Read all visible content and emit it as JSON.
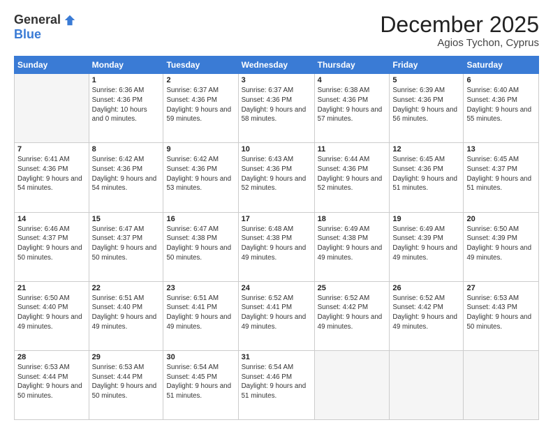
{
  "header": {
    "logo_general": "General",
    "logo_blue": "Blue",
    "month": "December 2025",
    "location": "Agios Tychon, Cyprus"
  },
  "weekdays": [
    "Sunday",
    "Monday",
    "Tuesday",
    "Wednesday",
    "Thursday",
    "Friday",
    "Saturday"
  ],
  "weeks": [
    [
      {
        "day": "",
        "sunrise": "",
        "sunset": "",
        "daylight": ""
      },
      {
        "day": "1",
        "sunrise": "Sunrise: 6:36 AM",
        "sunset": "Sunset: 4:36 PM",
        "daylight": "Daylight: 10 hours and 0 minutes."
      },
      {
        "day": "2",
        "sunrise": "Sunrise: 6:37 AM",
        "sunset": "Sunset: 4:36 PM",
        "daylight": "Daylight: 9 hours and 59 minutes."
      },
      {
        "day": "3",
        "sunrise": "Sunrise: 6:37 AM",
        "sunset": "Sunset: 4:36 PM",
        "daylight": "Daylight: 9 hours and 58 minutes."
      },
      {
        "day": "4",
        "sunrise": "Sunrise: 6:38 AM",
        "sunset": "Sunset: 4:36 PM",
        "daylight": "Daylight: 9 hours and 57 minutes."
      },
      {
        "day": "5",
        "sunrise": "Sunrise: 6:39 AM",
        "sunset": "Sunset: 4:36 PM",
        "daylight": "Daylight: 9 hours and 56 minutes."
      },
      {
        "day": "6",
        "sunrise": "Sunrise: 6:40 AM",
        "sunset": "Sunset: 4:36 PM",
        "daylight": "Daylight: 9 hours and 55 minutes."
      }
    ],
    [
      {
        "day": "7",
        "sunrise": "Sunrise: 6:41 AM",
        "sunset": "Sunset: 4:36 PM",
        "daylight": "Daylight: 9 hours and 54 minutes."
      },
      {
        "day": "8",
        "sunrise": "Sunrise: 6:42 AM",
        "sunset": "Sunset: 4:36 PM",
        "daylight": "Daylight: 9 hours and 54 minutes."
      },
      {
        "day": "9",
        "sunrise": "Sunrise: 6:42 AM",
        "sunset": "Sunset: 4:36 PM",
        "daylight": "Daylight: 9 hours and 53 minutes."
      },
      {
        "day": "10",
        "sunrise": "Sunrise: 6:43 AM",
        "sunset": "Sunset: 4:36 PM",
        "daylight": "Daylight: 9 hours and 52 minutes."
      },
      {
        "day": "11",
        "sunrise": "Sunrise: 6:44 AM",
        "sunset": "Sunset: 4:36 PM",
        "daylight": "Daylight: 9 hours and 52 minutes."
      },
      {
        "day": "12",
        "sunrise": "Sunrise: 6:45 AM",
        "sunset": "Sunset: 4:36 PM",
        "daylight": "Daylight: 9 hours and 51 minutes."
      },
      {
        "day": "13",
        "sunrise": "Sunrise: 6:45 AM",
        "sunset": "Sunset: 4:37 PM",
        "daylight": "Daylight: 9 hours and 51 minutes."
      }
    ],
    [
      {
        "day": "14",
        "sunrise": "Sunrise: 6:46 AM",
        "sunset": "Sunset: 4:37 PM",
        "daylight": "Daylight: 9 hours and 50 minutes."
      },
      {
        "day": "15",
        "sunrise": "Sunrise: 6:47 AM",
        "sunset": "Sunset: 4:37 PM",
        "daylight": "Daylight: 9 hours and 50 minutes."
      },
      {
        "day": "16",
        "sunrise": "Sunrise: 6:47 AM",
        "sunset": "Sunset: 4:38 PM",
        "daylight": "Daylight: 9 hours and 50 minutes."
      },
      {
        "day": "17",
        "sunrise": "Sunrise: 6:48 AM",
        "sunset": "Sunset: 4:38 PM",
        "daylight": "Daylight: 9 hours and 49 minutes."
      },
      {
        "day": "18",
        "sunrise": "Sunrise: 6:49 AM",
        "sunset": "Sunset: 4:38 PM",
        "daylight": "Daylight: 9 hours and 49 minutes."
      },
      {
        "day": "19",
        "sunrise": "Sunrise: 6:49 AM",
        "sunset": "Sunset: 4:39 PM",
        "daylight": "Daylight: 9 hours and 49 minutes."
      },
      {
        "day": "20",
        "sunrise": "Sunrise: 6:50 AM",
        "sunset": "Sunset: 4:39 PM",
        "daylight": "Daylight: 9 hours and 49 minutes."
      }
    ],
    [
      {
        "day": "21",
        "sunrise": "Sunrise: 6:50 AM",
        "sunset": "Sunset: 4:40 PM",
        "daylight": "Daylight: 9 hours and 49 minutes."
      },
      {
        "day": "22",
        "sunrise": "Sunrise: 6:51 AM",
        "sunset": "Sunset: 4:40 PM",
        "daylight": "Daylight: 9 hours and 49 minutes."
      },
      {
        "day": "23",
        "sunrise": "Sunrise: 6:51 AM",
        "sunset": "Sunset: 4:41 PM",
        "daylight": "Daylight: 9 hours and 49 minutes."
      },
      {
        "day": "24",
        "sunrise": "Sunrise: 6:52 AM",
        "sunset": "Sunset: 4:41 PM",
        "daylight": "Daylight: 9 hours and 49 minutes."
      },
      {
        "day": "25",
        "sunrise": "Sunrise: 6:52 AM",
        "sunset": "Sunset: 4:42 PM",
        "daylight": "Daylight: 9 hours and 49 minutes."
      },
      {
        "day": "26",
        "sunrise": "Sunrise: 6:52 AM",
        "sunset": "Sunset: 4:42 PM",
        "daylight": "Daylight: 9 hours and 49 minutes."
      },
      {
        "day": "27",
        "sunrise": "Sunrise: 6:53 AM",
        "sunset": "Sunset: 4:43 PM",
        "daylight": "Daylight: 9 hours and 50 minutes."
      }
    ],
    [
      {
        "day": "28",
        "sunrise": "Sunrise: 6:53 AM",
        "sunset": "Sunset: 4:44 PM",
        "daylight": "Daylight: 9 hours and 50 minutes."
      },
      {
        "day": "29",
        "sunrise": "Sunrise: 6:53 AM",
        "sunset": "Sunset: 4:44 PM",
        "daylight": "Daylight: 9 hours and 50 minutes."
      },
      {
        "day": "30",
        "sunrise": "Sunrise: 6:54 AM",
        "sunset": "Sunset: 4:45 PM",
        "daylight": "Daylight: 9 hours and 51 minutes."
      },
      {
        "day": "31",
        "sunrise": "Sunrise: 6:54 AM",
        "sunset": "Sunset: 4:46 PM",
        "daylight": "Daylight: 9 hours and 51 minutes."
      },
      {
        "day": "",
        "sunrise": "",
        "sunset": "",
        "daylight": ""
      },
      {
        "day": "",
        "sunrise": "",
        "sunset": "",
        "daylight": ""
      },
      {
        "day": "",
        "sunrise": "",
        "sunset": "",
        "daylight": ""
      }
    ]
  ]
}
